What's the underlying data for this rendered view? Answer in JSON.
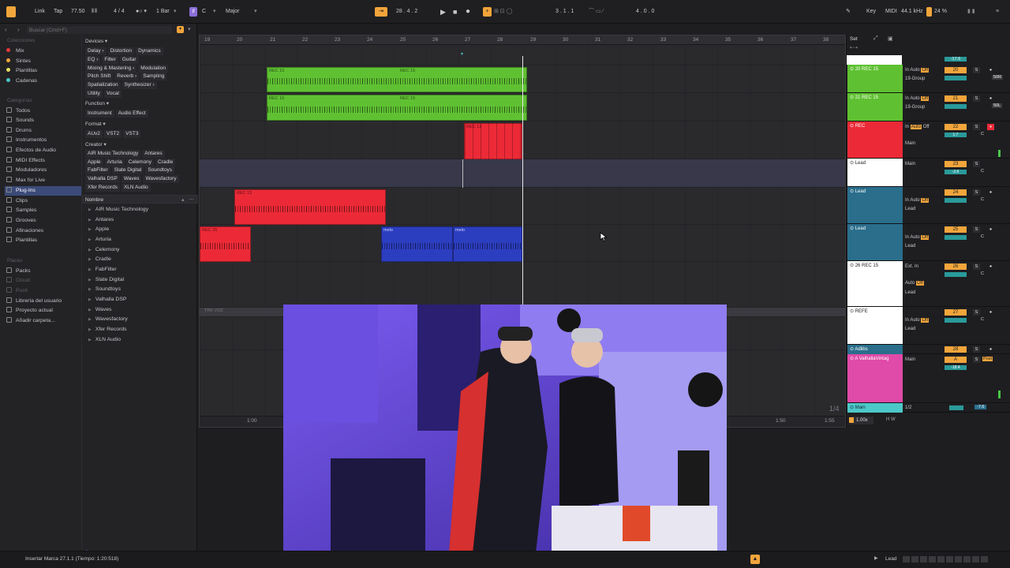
{
  "topbar": {
    "link": "Link",
    "tap": "Tap",
    "tempo": "77.50",
    "signature": "4 / 4",
    "quantize": "1 Bar",
    "key": "C",
    "scale": "Major",
    "position": "28 .  4 .  2",
    "loop_start": "3 .  1 .  1",
    "loop_len": "4 .  0 .  0",
    "key_label": "Key",
    "midi_label": "MIDI",
    "sample_rate": "44.1 kHz",
    "cpu": "24 %"
  },
  "browser": {
    "search_placeholder": "Buscar (Cmd+F)",
    "collections_title": "Colecciones",
    "collections": [
      {
        "label": "Mix",
        "color": "#e83a3a"
      },
      {
        "label": "Sintes",
        "color": "#f2a53b"
      },
      {
        "label": "Plantillas",
        "color": "#e8e060"
      },
      {
        "label": "Cadenas",
        "color": "#4cc8c8"
      }
    ],
    "categories_title": "Categorías",
    "categories": [
      "Todos",
      "Sounds",
      "Drums",
      "Instrumentos",
      "Efectos de Audio",
      "MIDI Effects",
      "Moduladores",
      "Max for Live",
      "Plug-Ins",
      "Clips",
      "Samples",
      "Grooves",
      "Afinaciones",
      "Plantillas"
    ],
    "places_title": "Places",
    "places": [
      "Packs",
      "Cloud",
      "Push",
      "Librería del usuario",
      "Proyecto actual",
      "Añadir carpeta..."
    ],
    "filters": {
      "devices_label": "Devices ▾",
      "devices_rows": [
        [
          "Delay ›",
          "Distortion",
          "Dynamics"
        ],
        [
          "EQ ›",
          "Filter",
          "Guitar"
        ],
        [
          "Mixing & Mastering ›",
          "Modulation"
        ],
        [
          "Pitch Shift",
          "Reverb ›",
          "Sampling"
        ],
        [
          "Spatialization",
          "Synthesizer ›"
        ],
        [
          "Utility",
          "Vocal"
        ]
      ],
      "function_label": "Function ▾",
      "function_rows": [
        [
          "Instrument",
          "Audio Effect"
        ]
      ],
      "format_label": "Format ▾",
      "format_rows": [
        [
          "AUv2",
          "VST2",
          "VST3"
        ]
      ],
      "creator_label": "Creator ▾",
      "creator_rows": [
        [
          "AIR Music Technology",
          "Antares"
        ],
        [
          "Apple",
          "Arturia",
          "Celemony",
          "Cradle"
        ],
        [
          "FabFilter",
          "Slate Digital",
          "Soundtoys"
        ],
        [
          "Valhalla DSP",
          "Waves",
          "Wavesfactory"
        ],
        [
          "Xfer Records",
          "XLN Audio"
        ]
      ]
    },
    "name_header": "Nombre",
    "tree": [
      "AIR Music Technology",
      "Antares",
      "Apple",
      "Arturia",
      "Celemony",
      "Cradle",
      "FabFilter",
      "Slate Digital",
      "Soundtoys",
      "Valhalla DSP",
      "Waves",
      "Wavesfactory",
      "Xfer Records",
      "XLN Audio"
    ]
  },
  "arrangement": {
    "ruler": [
      "19",
      "20",
      "21",
      "22",
      "23",
      "24",
      "25",
      "26",
      "27",
      "28",
      "29",
      "30",
      "31",
      "32",
      "33",
      "34",
      "35",
      "36",
      "37",
      "38"
    ],
    "clips": [
      {
        "name": "REC 15",
        "color": "#5fc132"
      },
      {
        "name": "REC 15",
        "color": "#5fc132"
      },
      {
        "name": "REC 15",
        "color": "#5fc132"
      },
      {
        "name": "REC 15",
        "color": "#5fc132"
      },
      {
        "name": "REC 12",
        "color": "#ec2a37"
      },
      {
        "name": "REC 15",
        "color": "#ec2a37"
      },
      {
        "name": "REC 25",
        "color": "#ec2a37"
      },
      {
        "name": "melo",
        "color": "#2c3ec0"
      },
      {
        "name": "melo",
        "color": "#2c3ec0"
      }
    ],
    "return_label": "TRK VOZ",
    "time_marks": [
      "1:00",
      "1:50",
      "1:55"
    ],
    "grid_label": "1/4"
  },
  "mixer": {
    "set_label": "Set",
    "master_db": "-17.6",
    "tracks": [
      {
        "name": "20 REC 15",
        "color": "#5fc132",
        "num": "20",
        "in": "In",
        "auto": "Auto",
        "off": "Off",
        "group": "19-Group",
        "vol": "0",
        "pan": "50R"
      },
      {
        "name": "21 REC 15",
        "color": "#5fc132",
        "num": "21",
        "in": "In",
        "auto": "Auto",
        "off": "Off",
        "group": "19-Group",
        "vol": "0",
        "pan": "50L"
      },
      {
        "name": "REC",
        "color": "#ec2a37",
        "num": "22",
        "in": "In",
        "auto": "Auto",
        "off": "Off",
        "group": "Main",
        "vol": "1.7",
        "pan": "C"
      },
      {
        "name": "Lead",
        "color": "#ffffff",
        "num": "23",
        "in": "",
        "auto": "",
        "off": "",
        "group": "Main",
        "vol": "-2.6",
        "pan": "C"
      },
      {
        "name": "Lead",
        "color": "#2a6e8c",
        "num": "24",
        "in": "In",
        "auto": "Auto",
        "off": "Off",
        "group": "Lead",
        "vol": "0",
        "pan": "C"
      },
      {
        "name": "Lead",
        "color": "#2a6e8c",
        "num": "25",
        "in": "In",
        "auto": "Auto",
        "off": "Off",
        "group": "Lead",
        "vol": "0",
        "pan": "C"
      },
      {
        "name": "26 REC 15",
        "color": "#ffffff",
        "num": "26",
        "in": "Ext. In",
        "auto": "Auto",
        "off": "Off",
        "group": "Lead",
        "vol": "0",
        "pan": "C"
      },
      {
        "name": "REFE",
        "color": "#ffffff",
        "num": "27",
        "in": "In",
        "auto": "Auto",
        "off": "Off",
        "group": "Lead",
        "vol": "0",
        "pan": "C"
      },
      {
        "name": "Adlibs",
        "color": "#2a6e8c",
        "num": "28",
        "in": "",
        "auto": "",
        "off": "",
        "group": "",
        "vol": "",
        "pan": ""
      },
      {
        "name": "A ValhallaVintag",
        "color": "#e04aa8",
        "num": "A",
        "in": "",
        "auto": "",
        "off": "",
        "group": "Main",
        "vol": "-18.4",
        "pan": "Post"
      },
      {
        "name": "Main",
        "color": "#4cc8c8",
        "num": "",
        "in": "",
        "auto": "",
        "off": "",
        "group": "1/2",
        "vol": "0",
        "pan": "-7.6"
      }
    ],
    "zoom": "1.00x"
  },
  "status": {
    "message": "Insertar Marca 27.1.1 (Tiempo: 1:20:518)",
    "track": "Lead"
  },
  "webcam": {
    "description_icon": "webcam-overlay"
  }
}
